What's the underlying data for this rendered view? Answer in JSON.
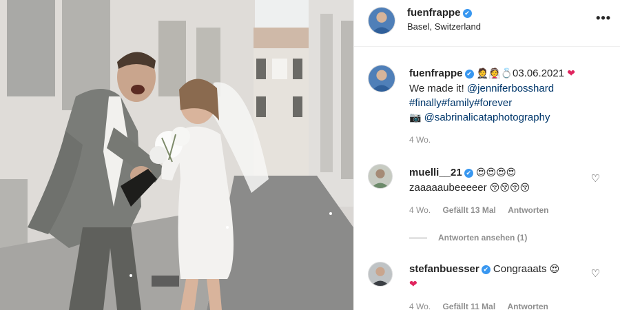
{
  "post": {
    "author": "fuenfrappe",
    "location": "Basel, Switzerland",
    "verified_mark": "✔",
    "more_label": "•••"
  },
  "caption": {
    "author": "fuenfrappe",
    "emojis": "🤵👰💍",
    "date": "03.06.2021",
    "heart": "❤",
    "text_start": "We made it! ",
    "mention1": "@jenniferbosshard",
    "hashtags": "#finally#family#forever",
    "camera": "📷",
    "mention2": "@sabrinalicataphotography",
    "time": "4 Wo."
  },
  "comments": [
    {
      "author": "muelli__21",
      "emojis_line1": "😍😍😍😍",
      "text": "zaaaaaubeeeeer",
      "emojis_line2": "😚😚😚😚",
      "time": "4 Wo.",
      "likes": "Gefällt 13 Mal",
      "reply": "Antworten"
    },
    {
      "author": "stefanbuesser",
      "text": "Congraaats",
      "emoji1": "😍",
      "heart": "❤",
      "time": "4 Wo.",
      "likes": "Gefällt 11 Mal",
      "reply": "Antworten"
    }
  ],
  "replies_toggle": "Antworten ansehen (1)",
  "icons": {
    "like": "heart-outline-icon",
    "verified": "verified-badge-icon",
    "more": "more-options-icon"
  },
  "colors": {
    "link": "#00376b",
    "verified": "#3897f0",
    "muted": "#8e8e8e",
    "heart": "#e0245e"
  }
}
